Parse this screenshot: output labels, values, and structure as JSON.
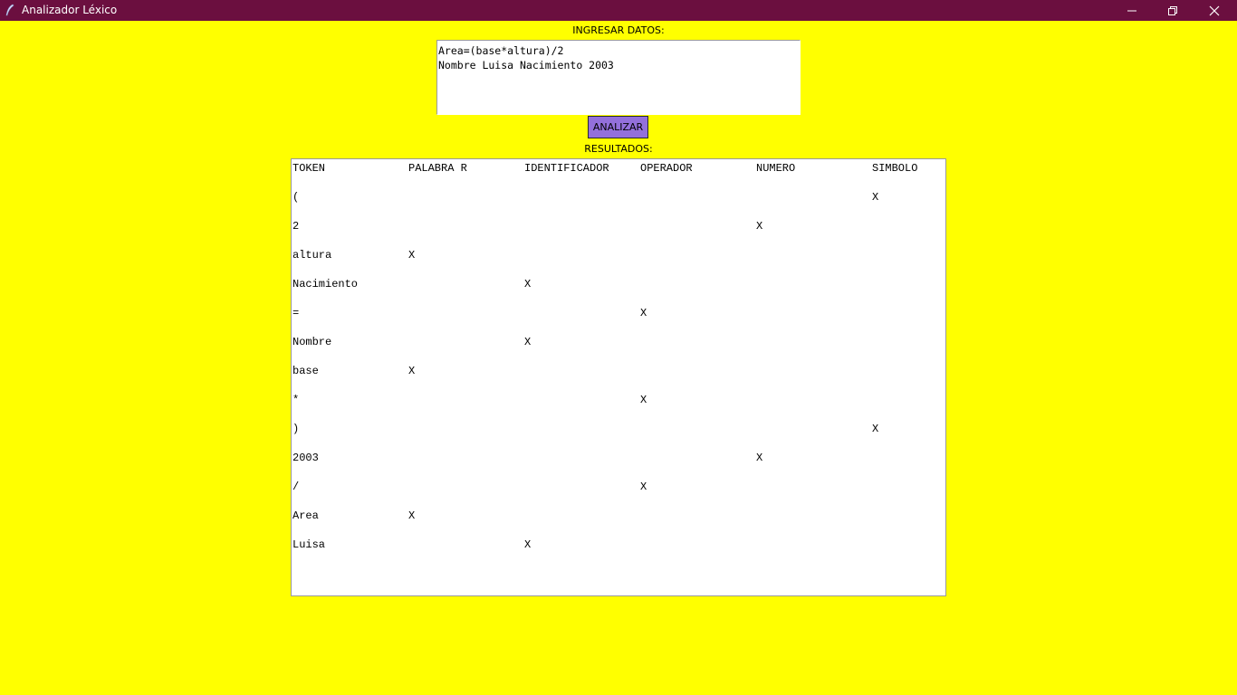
{
  "window": {
    "title": "Analizador Léxico"
  },
  "input": {
    "label": "INGRESAR DATOS:",
    "lines": [
      "Area=(base*altura)/2",
      "Nombre Luisa Nacimiento 2003"
    ]
  },
  "analyze_button": {
    "label": "ANALIZAR",
    "color": "#9370db"
  },
  "results": {
    "label": "RESULTADOS:",
    "headers": [
      "TOKEN",
      "PALABRA R",
      "IDENTIFICADOR",
      "OPERADOR",
      "NUMERO",
      "SIMBOLO"
    ],
    "rows": [
      [
        "(",
        "",
        "",
        "",
        "",
        "X"
      ],
      [
        "2",
        "",
        "",
        "",
        "X",
        ""
      ],
      [
        "altura",
        "X",
        "",
        "",
        "",
        ""
      ],
      [
        "Nacimiento",
        "",
        "X",
        "",
        "",
        ""
      ],
      [
        "=",
        "",
        "",
        "X",
        "",
        ""
      ],
      [
        "Nombre",
        "",
        "X",
        "",
        "",
        ""
      ],
      [
        "base",
        "X",
        "",
        "",
        "",
        ""
      ],
      [
        "*",
        "",
        "",
        "X",
        "",
        ""
      ],
      [
        ")",
        "",
        "",
        "",
        "",
        "X"
      ],
      [
        "2003",
        "",
        "",
        "",
        "X",
        ""
      ],
      [
        "/",
        "",
        "",
        "X",
        "",
        ""
      ],
      [
        "Area",
        "X",
        "",
        "",
        "",
        ""
      ],
      [
        "Luisa",
        "",
        "X",
        "",
        "",
        ""
      ]
    ]
  },
  "colors": {
    "background": "#ffff00",
    "titlebar": "#6b0f3f"
  }
}
